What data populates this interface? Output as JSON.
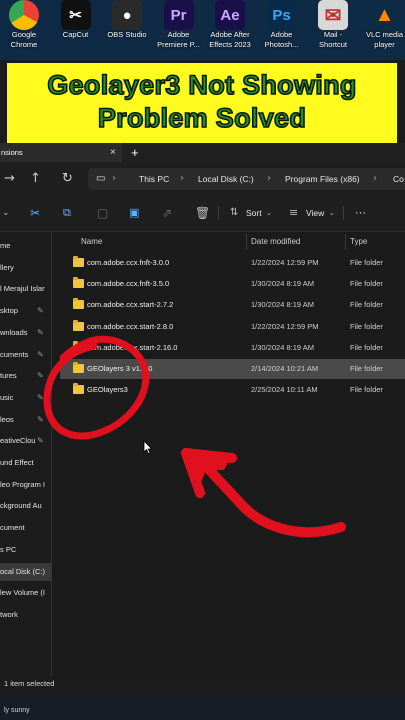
{
  "desktop": {
    "icons": [
      {
        "label1": "Google",
        "label2": "Chrome",
        "glyph": "",
        "color": "#e8453c",
        "icon": "chrome-icon"
      },
      {
        "label1": "CapCut",
        "label2": "",
        "glyph": "✂",
        "color": "#111111",
        "icon": "capcut-icon"
      },
      {
        "label1": "OBS Studio",
        "label2": "",
        "glyph": "●",
        "color": "#2a2a2a",
        "icon": "obs-icon"
      },
      {
        "label1": "Adobe",
        "label2": "Premiere P...",
        "glyph": "Pr",
        "color": "#1b0f4a",
        "icon": "premiere-icon"
      },
      {
        "label1": "Adobe After",
        "label2": "Effects 2023",
        "glyph": "Ae",
        "color": "#1b0f4a",
        "icon": "after-effects-icon"
      },
      {
        "label1": "Adobe",
        "label2": "Photosh...",
        "glyph": "Ps",
        "color": "#0b2a4a",
        "icon": "photoshop-icon"
      },
      {
        "label1": "Mail -",
        "label2": "Shortcut",
        "glyph": "✉",
        "color": "#d8d8d8",
        "icon": "mail-icon"
      },
      {
        "label1": "VLC media",
        "label2": "player",
        "glyph": "▲",
        "color": "#0f2a44",
        "icon": "vlc-icon"
      }
    ]
  },
  "banner": {
    "line1": "Geolayer3 Not Showing",
    "line2": "Problem Solved"
  },
  "tab": {
    "label": "nsions",
    "close": "×",
    "new": "+"
  },
  "breadcrumb": [
    "This PC",
    "Local Disk (C:)",
    "Program Files (x86)",
    "Co"
  ],
  "command_bar": {
    "sort": "Sort",
    "view": "View",
    "more": "···"
  },
  "columns": {
    "name": "Name",
    "date": "Date modified",
    "type": "Type"
  },
  "sidebar": {
    "items": [
      {
        "label": "me",
        "pin": false
      },
      {
        "label": "llery",
        "pin": false
      },
      {
        "label": "l Merajul Islar",
        "pin": false
      },
      {
        "label": "sktop",
        "pin": true
      },
      {
        "label": "wnloads",
        "pin": true
      },
      {
        "label": "cuments",
        "pin": true
      },
      {
        "label": "tures",
        "pin": true
      },
      {
        "label": "usic",
        "pin": true
      },
      {
        "label": "leos",
        "pin": true
      },
      {
        "label": "eativeClou",
        "pin": true
      },
      {
        "label": "und Effect",
        "pin": false
      },
      {
        "label": "leo Program I",
        "pin": false
      },
      {
        "label": "ckground Au",
        "pin": false
      },
      {
        "label": "cument",
        "pin": false
      },
      {
        "label": "s PC",
        "pin": false
      },
      {
        "label": "ocal Disk (C:)",
        "pin": false,
        "active": true
      },
      {
        "label": "lew Volume (I",
        "pin": false
      },
      {
        "label": "twork",
        "pin": false
      }
    ]
  },
  "files": [
    {
      "name": "com.adobe.ccx.fnft-3.0.0",
      "date": "1/22/2024 12:59 PM",
      "type": "File folder"
    },
    {
      "name": "com.adobe.ccx.fnft-3.5.0",
      "date": "1/30/2024 8:19 AM",
      "type": "File folder"
    },
    {
      "name": "com.adobe.ccx.start-2.7.2",
      "date": "1/30/2024 8:19 AM",
      "type": "File folder"
    },
    {
      "name": "com.adobe.ccx.start-2.8.0",
      "date": "1/22/2024 12:59 PM",
      "type": "File folder"
    },
    {
      "name": "com.adobe.ccx.start-2.16.0",
      "date": "1/30/2024 8:19 AM",
      "type": "File folder"
    },
    {
      "name": "GEOlayers 3 v1.6.0",
      "date": "2/14/2024 10:21 AM",
      "type": "File folder",
      "selected": true
    },
    {
      "name": "GEOlayers3",
      "date": "2/25/2024 10:11 AM",
      "type": "File folder"
    }
  ],
  "status": {
    "text": "1 item selected"
  },
  "taskbar": {
    "weather": "ly sunny"
  },
  "colors": {
    "banner_bg": "#fffb1e",
    "banner_text": "#2a9128",
    "annotation_red": "#e0101e",
    "folder": "#f2c341"
  }
}
